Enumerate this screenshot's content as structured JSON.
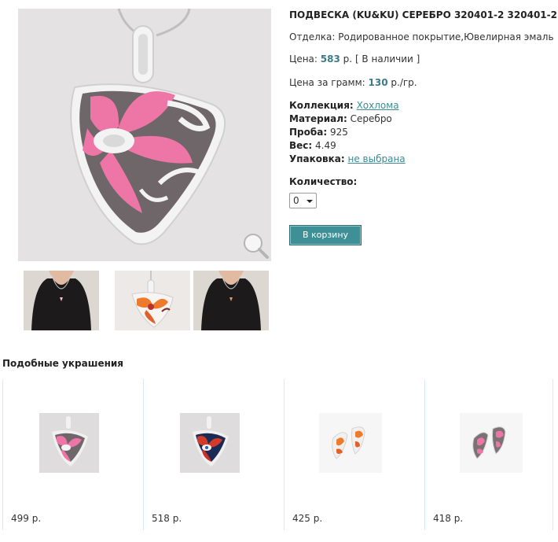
{
  "product": {
    "title": "ПОДВЕСКА (KU&KU) СЕРЕБРО 320401-2 320401-2",
    "finish_label": "Отделка:",
    "finish_value": "Родированное покрытие,Ювелирная эмаль",
    "price_label": "Цена:",
    "price_value": "583",
    "price_unit": "р.",
    "stock": "[ В наличии ]",
    "gram_price_label": "Цена за грамм:",
    "gram_price_value": "130",
    "gram_price_unit": "р./гр.",
    "collection_label": "Коллекция:",
    "collection_value": "Хохлома",
    "material_label": "Материал:",
    "material_value": "Серебро",
    "probe_label": "Проба:",
    "probe_value": "925",
    "weight_label": "Вес:",
    "weight_value": "4.49",
    "packaging_label": "Упаковка:",
    "packaging_value": "не выбрана",
    "quantity_label": "Количество:",
    "quantity_value": "0",
    "cart_button": "В корзину"
  },
  "gallery": {
    "thumbnails": [
      "model-necklace-photo",
      "pendant-orange-photo",
      "model-necklace-photo"
    ]
  },
  "similar": {
    "title": "Подобные украшения",
    "items": [
      {
        "price": "499 р.",
        "image": "pink-pendant"
      },
      {
        "price": "518 р.",
        "image": "red-pendant"
      },
      {
        "price": "425 р.",
        "image": "orange-earrings"
      },
      {
        "price": "418 р.",
        "image": "pink-earrings"
      }
    ]
  },
  "colors": {
    "accent": "#3a7b86",
    "button": "#3f8f96",
    "enamel_pink": "#ee76a6",
    "enamel_grey": "#6e6668"
  }
}
